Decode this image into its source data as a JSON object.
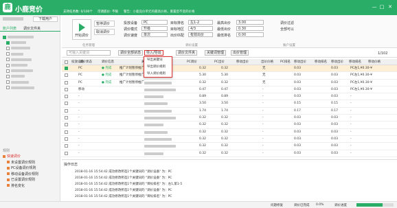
{
  "app": {
    "title": "小鹿竞价",
    "minimize": "—",
    "maximize": "□",
    "close": "✕"
  },
  "sidebar": {
    "login_button": "下载用户",
    "tab_accounts": "账户列表",
    "tab_files": "调价文件夹",
    "rule_title": "规则",
    "rules": [
      "快速调价",
      "未设置调价规则",
      "PC设备调价规则",
      "移动设备调价规则",
      "已设置调价规则",
      "排名变化"
    ]
  },
  "topbar": {
    "support": "支持任务数: 0/100个",
    "status": "可调底价: 不限",
    "notice": "警告：小鹿竞价单元的最高价格，重置后不变的价格",
    "start": "开始调价",
    "pause": "暂停调价",
    "cancel": "取消调价",
    "group1": "任务管理",
    "label_device": "投放设备",
    "device": "PC",
    "label_mode": "调价模式",
    "mode": "升级",
    "label_speed": "调价速度",
    "speed": "单次",
    "label_region": "目标排名",
    "region": "左1-2",
    "label_region2": "目标地区",
    "region2": "4/3",
    "label_ranks": "调价时间",
    "ranks": "上午",
    "label_max": "最高出价",
    "max": "3.00",
    "label_min": "最低出价",
    "min": "0.30",
    "label_keyword": "出价匹配",
    "keyword": "有效出价",
    "label_maxpct": "最低排名",
    "maxpct": "0.00",
    "group2": "调价设置",
    "filter_hint": "调价过滤",
    "clean_hint": "全部可以",
    "group3": "账户设置"
  },
  "filterbar": {
    "search_placeholder": "可输入关键词",
    "status_button": "调价全部状态",
    "import_export": "导入/导出",
    "folder_button": "调价文件夹",
    "folder_manage": "关键词管理",
    "plan_manage": "出价管理",
    "page": "1/102"
  },
  "dropdown": {
    "items": [
      "导出关键词",
      "导出调价规则",
      "导入调价规则"
    ]
  },
  "table": {
    "headers": [
      "投放设备",
      "调价状态",
      "调价信息",
      "关键词",
      "PC调价",
      "PC出价",
      "移动出价",
      "出价价格",
      "PC排名",
      "移动出价",
      "移动排名",
      "移动出价",
      "移动排名",
      "移动价格"
    ],
    "rows": [
      {
        "device": "PC",
        "status": "● 完成",
        "info": "推广计划暂停推广",
        "v1": "0.32",
        "v2": "0.32",
        "rank": "无",
        "v3": "0.03",
        "v4": "0.03",
        "tail": "PC左1,¥0.30-¥"
      },
      {
        "device": "PC",
        "status": "● 完成",
        "info": "推广计划暂停推广",
        "v1": "5.30",
        "v2": "5.30",
        "rank": "无",
        "v3": "0.03",
        "v4": "0.03",
        "tail": "PC左1,¥0.30-¥"
      },
      {
        "device": "PC",
        "status": "● 完成",
        "info": "推广计划暂停推广",
        "v1": "0.32",
        "v2": "0.32",
        "rank": "无",
        "v3": "0.03",
        "v4": "0.03",
        "tail": "PC左1,¥0.30-¥"
      },
      {
        "device": "移动",
        "status": "",
        "info": "",
        "v1": "0.47",
        "v2": "0.47",
        "rank": "-",
        "v3": "0.03",
        "v4": "0.03",
        "tail": "PC左1,¥0.30-¥"
      },
      {
        "device": "-",
        "status": "",
        "info": "",
        "v1": "0.89",
        "v2": "0.89",
        "rank": "-",
        "v3": "0.03",
        "v4": "0.03",
        "tail": "-"
      },
      {
        "device": "-",
        "status": "",
        "info": "",
        "v1": "3.50",
        "v2": "3.50",
        "rank": "-",
        "v3": "0.15",
        "v4": "0.15",
        "tail": "-"
      },
      {
        "device": "-",
        "status": "",
        "info": "",
        "v1": "1.74",
        "v2": "1.74",
        "rank": "-",
        "v3": "0.17",
        "v4": "0.17",
        "tail": "-"
      },
      {
        "device": "-",
        "status": "",
        "info": "",
        "v1": "0.32",
        "v2": "0.32",
        "rank": "-",
        "v3": "0.03",
        "v4": "0.03",
        "tail": "-"
      },
      {
        "device": "-",
        "status": "",
        "info": "",
        "v1": "0.32",
        "v2": "0.32",
        "rank": "-",
        "v3": "0.03",
        "v4": "0.03",
        "tail": "-"
      },
      {
        "device": "-",
        "status": "",
        "info": "",
        "v1": "0.32",
        "v2": "0.32",
        "rank": "-",
        "v3": "0.03",
        "v4": "0.03",
        "tail": "-"
      },
      {
        "device": "-",
        "status": "",
        "info": "",
        "v1": "0.32",
        "v2": "0.32",
        "rank": "-",
        "v3": "0.03",
        "v4": "0.03",
        "tail": "-"
      },
      {
        "device": "-",
        "status": "",
        "info": "",
        "v1": "0.32",
        "v2": "0.32",
        "rank": "-",
        "v3": "0.03",
        "v4": "0.03",
        "tail": "-"
      },
      {
        "device": "-",
        "status": "",
        "info": "",
        "v1": "0.32",
        "v2": "0.32",
        "rank": "-",
        "v3": "0.03",
        "v4": "0.03",
        "tail": "-"
      }
    ]
  },
  "log": {
    "title": "操作日志",
    "lines": [
      "2018-01-16 15:54:42 成功修改所选1个关键词的 \"调价设备\" 为：PC",
      "2018-01-16 15:54:42 成功修改所选1个关键词的 \"调价设备\" 为：PC",
      "2018-01-16 15:54:42 成功修改所选1个关键词的 \"目标排名\" 为：左1,第1-5",
      "2018-01-16 15:54:42 成功修改所选1个关键词的 \"调价设备\" 为：PC",
      "2018-01-16 15:54:42 成功修改所选1个关键词的 \"目标排名\" 为：PC"
    ]
  },
  "status": {
    "ok": "问题修复",
    "done": "调价已完成",
    "pct": "0.0%",
    "progress": "调价进度",
    "progress_value": 0.7
  },
  "colors": {
    "brand": "#2aae67",
    "highlight": "#fcefd6",
    "dropdown_border": "#dd3333"
  }
}
